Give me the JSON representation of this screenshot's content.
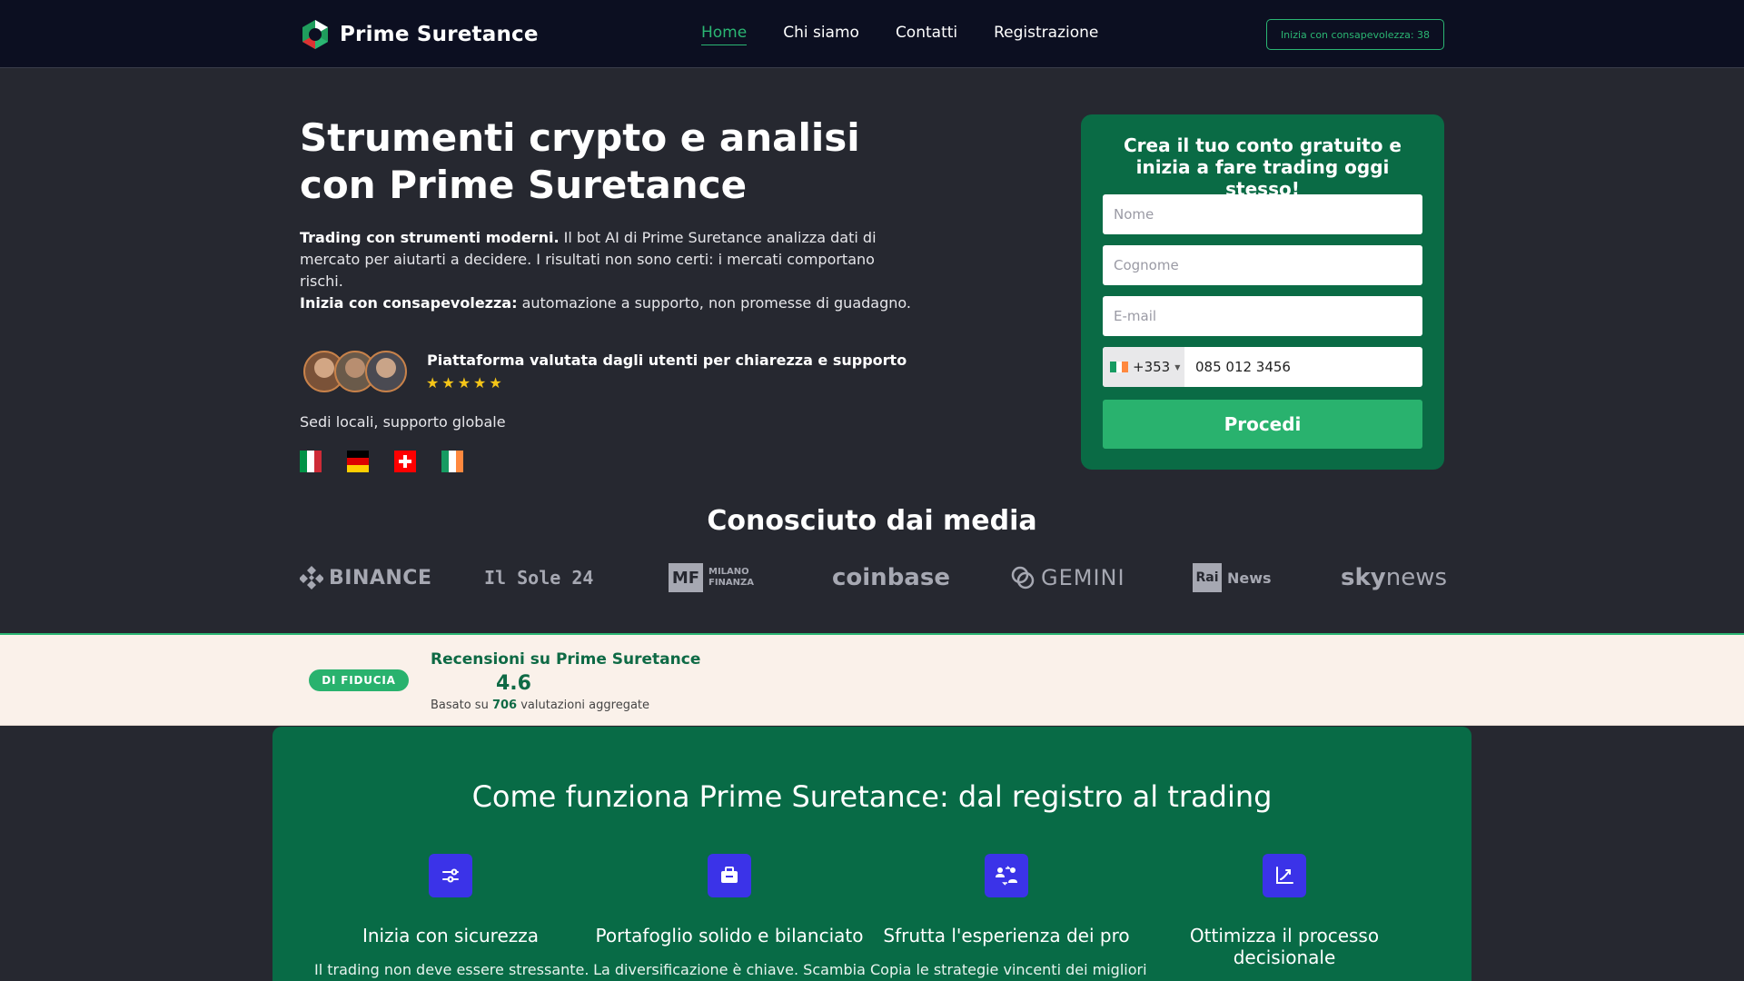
{
  "header": {
    "brand": "Prime Suretance",
    "nav": [
      "Home",
      "Chi siamo",
      "Contatti",
      "Registrazione"
    ],
    "cta": "Inizia con consapevolezza: 38"
  },
  "hero": {
    "title": "Strumenti crypto e analisi con Prime Suretance",
    "p1_bold": "Trading con strumenti moderni.",
    "p1_text": " Il bot AI di Prime Suretance analizza dati di mercato per aiutarti a decidere. I risultati non sono certi: i mercati comportano rischi.",
    "p2_bold": "Inizia con consapevolezza:",
    "p2_text": " automazione a supporto, non promesse di guadagno.",
    "rating_text": "Piattaforma valutata dagli utenti per chiarezza e supporto",
    "stars": 5,
    "sedi": "Sedi locali, supporto globale",
    "flags": [
      "italy",
      "germany",
      "switzerland",
      "ireland"
    ]
  },
  "form": {
    "title": "Crea il tuo conto gratuito e inizia a fare trading oggi stesso!",
    "first_name_placeholder": "Nome",
    "last_name_placeholder": "Cognome",
    "email_placeholder": "E-mail",
    "phone_code": "+353",
    "phone_value": "085 012 3456",
    "submit": "Procedi"
  },
  "media": {
    "title": "Conosciuto dai media",
    "logos": {
      "binance": "BINANCE",
      "sole": "Il Sole 24",
      "mf_box": "MF",
      "mf_line1": "MILANO",
      "mf_line2": "FINANZA",
      "coinbase": "coinbase",
      "gemini": "GEMINI",
      "rai_box": "Rai",
      "rai_text": "News",
      "sky_bold": "sky",
      "sky_text": "news"
    }
  },
  "reviews": {
    "badge": "DI FIDUCIA",
    "title": "Recensioni su Prime Suretance",
    "score": "4.6",
    "basis_prefix": "Basato su ",
    "basis_count": "706",
    "basis_suffix": " valutazioni aggregate"
  },
  "how": {
    "title": "Come funziona Prime Suretance: dal registro al trading",
    "steps": [
      {
        "title": "Inizia con sicurezza",
        "desc": "Il trading non deve essere stressante.",
        "icon": "sliders-icon"
      },
      {
        "title": "Portafoglio solido e bilanciato",
        "desc": "La diversificazione è chiave. Scambia",
        "icon": "briefcase-icon"
      },
      {
        "title": "Sfrutta l'esperienza dei pro",
        "desc": "Copia le strategie vincenti dei migliori",
        "icon": "users-exchange-icon"
      },
      {
        "title": "Ottimizza il processo decisionale",
        "desc": "",
        "icon": "chart-growth-icon"
      }
    ]
  },
  "colors": {
    "header_bg": "#0c0f21",
    "page_bg": "#262830",
    "accent_green": "#2bb673",
    "form_bg": "#0a6b45",
    "icon_blue": "#3b33e8"
  }
}
